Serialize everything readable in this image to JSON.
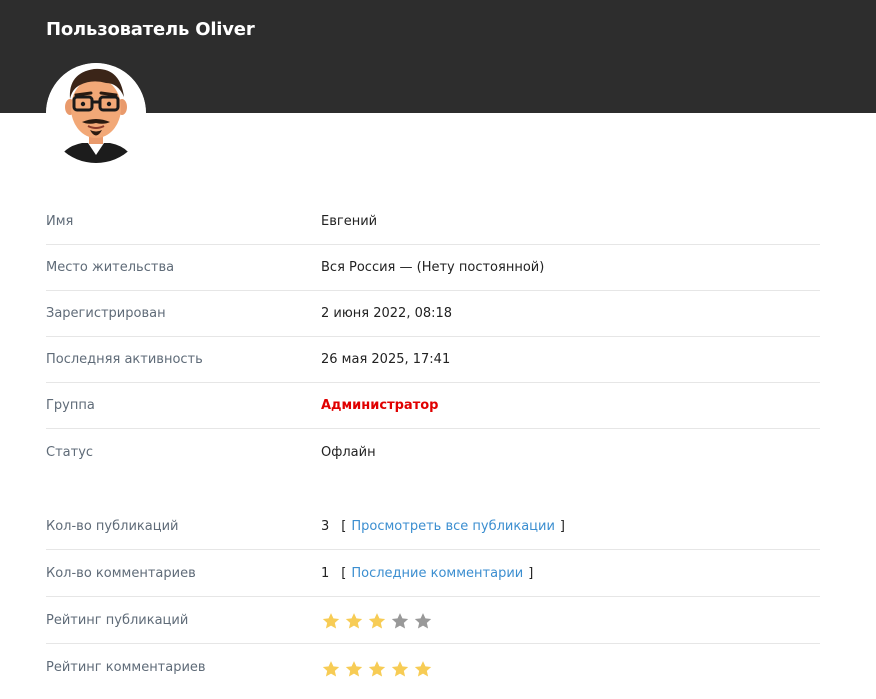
{
  "header": {
    "title": "Пользователь Oliver"
  },
  "profile": {
    "rows": [
      {
        "label": "Имя",
        "value": "Евгений"
      },
      {
        "label": "Место жительства",
        "value": "Вся Россия — (Нету постоянной)"
      },
      {
        "label": "Зарегистрирован",
        "value": "2 июня 2022, 08:18"
      },
      {
        "label": "Последняя активность",
        "value": "26 мая 2025, 17:41"
      },
      {
        "label": "Группа",
        "value": "Администратор"
      },
      {
        "label": "Статус",
        "value": "Офлайн"
      }
    ]
  },
  "stats": {
    "publications": {
      "label": "Кол-во публикаций",
      "count": "3",
      "bracket_open": "[",
      "link": "Просмотреть все публикации",
      "bracket_close": "]"
    },
    "comments": {
      "label": "Кол-во комментариев",
      "count": "1",
      "bracket_open": "[",
      "link": "Последние комментарии",
      "bracket_close": "]"
    },
    "publication_rating": {
      "label": "Рейтинг публикаций",
      "stars": 3,
      "max": 5
    },
    "comment_rating": {
      "label": "Рейтинг комментариев",
      "stars": 5,
      "max": 5
    }
  },
  "colors": {
    "header_bg": "#2d2d2d",
    "admin": "#e00000",
    "link": "#3b8ed0",
    "star_on": "#f7cc55",
    "star_off": "#999999"
  },
  "icons": {
    "avatar": "avatar-icon",
    "star": "star-icon"
  }
}
